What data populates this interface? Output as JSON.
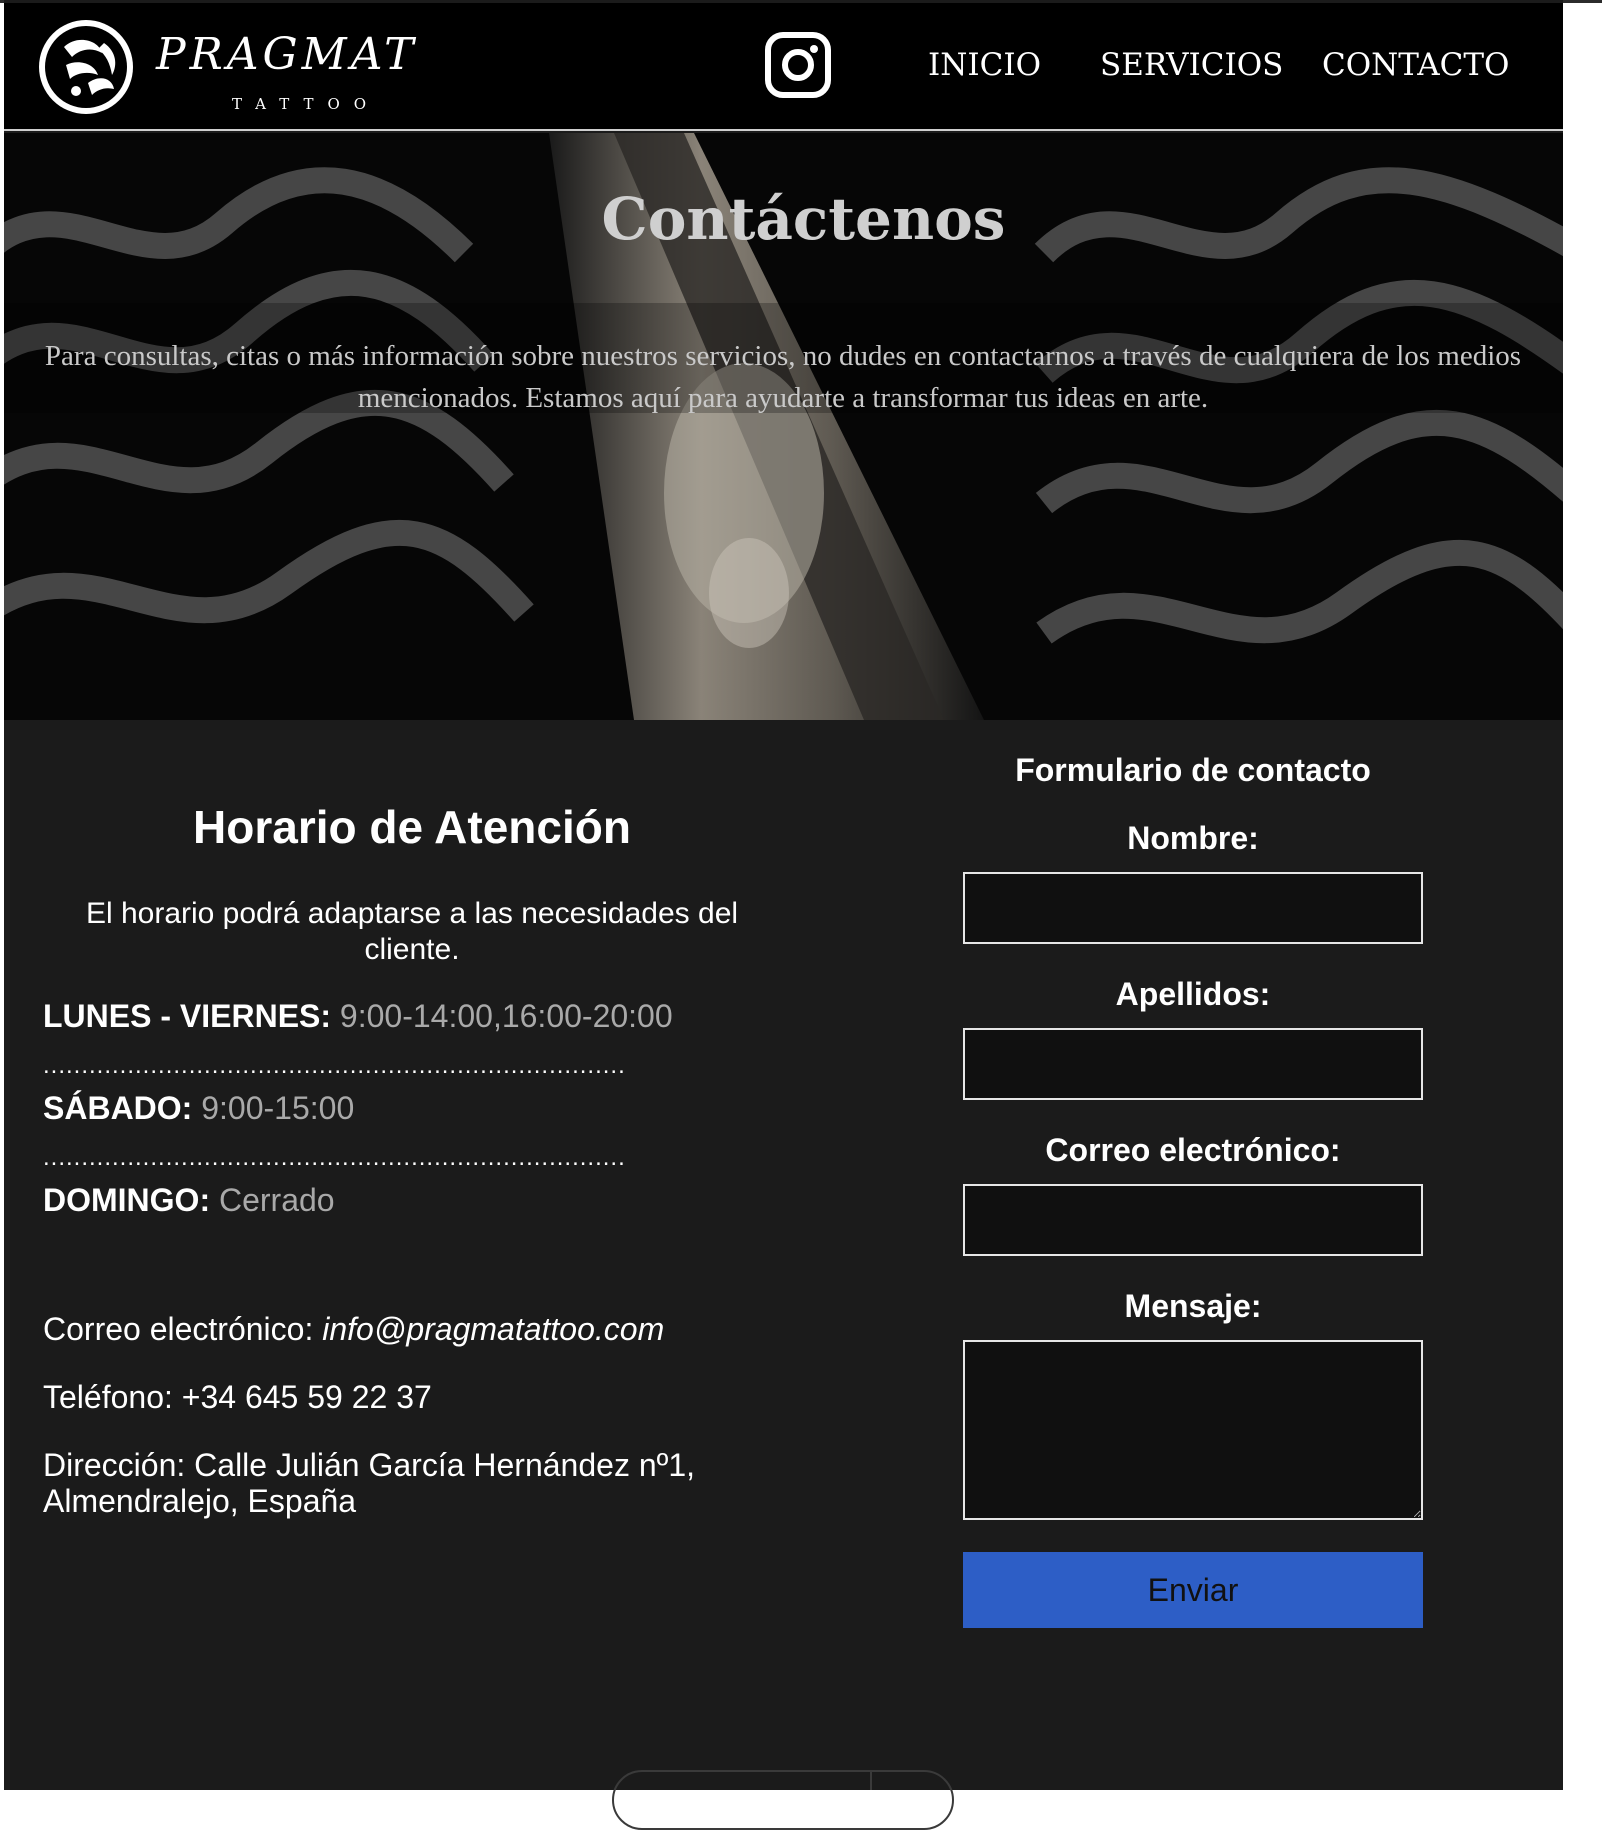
{
  "header": {
    "brand": "PRAGMAT",
    "brand_sub": "TATTOO",
    "nav": [
      {
        "label": "INICIO"
      },
      {
        "label": "SERVICIOS"
      },
      {
        "label": "CONTACTO"
      }
    ],
    "icons": {
      "logo": "koi-fish-logo-icon",
      "social": "instagram-icon"
    }
  },
  "hero": {
    "title": "Contáctenos",
    "text": "Para consultas, citas o más información sobre nuestros servicios, no dudes en contactarnos a través de cualquiera de los medios mencionados. Estamos aquí para ayudarte a transformar tus ideas en arte."
  },
  "schedule": {
    "title": "Horario de Atención",
    "note": "El horario podrá adaptarse a las necesidades del cliente.",
    "rows": [
      {
        "day": "LUNES - VIERNES:",
        "hours": "9:00-14:00,16:00-20:00"
      },
      {
        "day": "SÁBADO:",
        "hours": "9:00-15:00"
      },
      {
        "day": "DOMINGO:",
        "hours": "Cerrado"
      }
    ],
    "separator": "............................................................................"
  },
  "contact": {
    "email_label": "Correo electrónico: ",
    "email_value": "info@pragmatattoo.com",
    "phone": "Teléfono: +34 645 59 22 37",
    "address": "Dirección: Calle Julián García Hernández nº1, Almendralejo, España"
  },
  "form": {
    "title": "Formulario de contacto",
    "fields": [
      {
        "label": "Nombre:",
        "value": ""
      },
      {
        "label": "Apellidos:",
        "value": ""
      },
      {
        "label": "Correo electrónico:",
        "value": ""
      },
      {
        "label": "Mensaje:",
        "value": ""
      }
    ],
    "submit_label": "Enviar"
  },
  "colors": {
    "page_bg": "#1b1b1b",
    "header_bg": "#000000",
    "button": "#2d5ec6",
    "muted_text": "#a9a9a9"
  }
}
